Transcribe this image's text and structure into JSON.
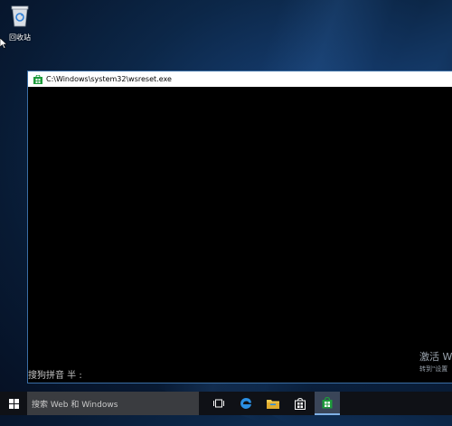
{
  "desktop": {
    "recycle_bin_label": "回收站"
  },
  "window": {
    "title": "C:\\Windows\\system32\\wsreset.exe",
    "ime_status": "搜狗拼音 半 :"
  },
  "watermark": {
    "line1": "激活 W",
    "line2": "转到\"设置"
  },
  "taskbar": {
    "search_placeholder": "搜索 Web 和 Windows",
    "items": [
      "task-view",
      "edge",
      "file-explorer",
      "store",
      "wsreset"
    ]
  },
  "colors": {
    "console_bg": "#000000",
    "taskbar_bg": "#0f1116",
    "store_green": "#1e9b3b",
    "edge_blue": "#2b8fe3"
  }
}
